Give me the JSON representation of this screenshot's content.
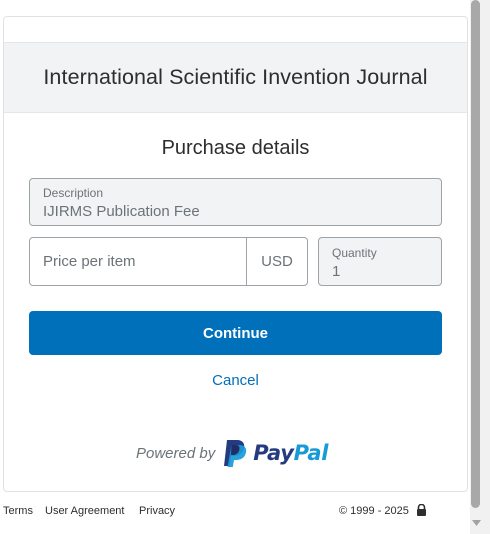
{
  "merchant": {
    "name": "International Scientific Invention Journal"
  },
  "purchase": {
    "title": "Purchase details",
    "description": {
      "label": "Description",
      "value": "IJIRMS Publication Fee"
    },
    "price": {
      "placeholder": "Price per item",
      "value": "",
      "currency": "USD"
    },
    "quantity": {
      "label": "Quantity",
      "value": "1"
    }
  },
  "actions": {
    "continue_label": "Continue",
    "cancel_label": "Cancel"
  },
  "branding": {
    "powered_by": "Powered by",
    "paypal_pay": "Pay",
    "paypal_pal": "Pal",
    "pay_color": "#253b80",
    "pal_color": "#179bd7"
  },
  "footer": {
    "terms": "Terms",
    "user_agreement": "User Agreement",
    "privacy": "Privacy",
    "copyright": "© 1999 - 2025",
    "lock_icon": "lock-icon"
  },
  "colors": {
    "accent": "#0070ba",
    "field_bg": "#f2f3f4",
    "border": "#9da3a6"
  }
}
